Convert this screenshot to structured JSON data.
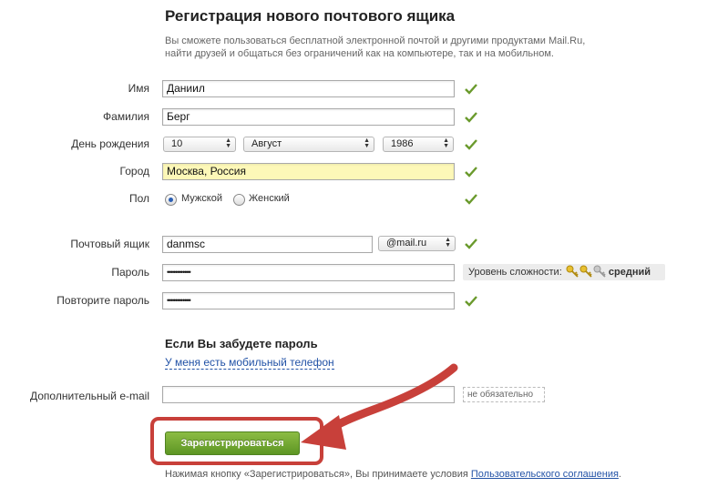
{
  "form": {
    "title": "Регистрация нового почтового ящика",
    "intro_line1": "Вы сможете пользоваться бесплатной электронной почтой и другими продуктами Mail.Ru,",
    "intro_line2": "найти друзей и общаться без ограничений как на компьютере, так и на мобильном.",
    "fields": {
      "name_label": "Имя",
      "name_value": "Даниил",
      "surname_label": "Фамилия",
      "surname_value": "Берг",
      "birthday_label": "День рождения",
      "birth_day": "10",
      "birth_month": "Август",
      "birth_year": "1986",
      "city_label": "Город",
      "city_value": "Москва, Россия",
      "gender_label": "Пол",
      "gender_male": "Мужской",
      "gender_female": "Женский",
      "gender_selected": "Мужской",
      "mailbox_label": "Почтовый ящик",
      "mailbox_value": "danmsc",
      "mailbox_domain": "@mail.ru",
      "password_label": "Пароль",
      "password_mask": "••••••••••••",
      "password_strength_label": "Уровень сложности:",
      "password_strength_value": "средний",
      "repeat_password_label": "Повторите пароль",
      "repeat_password_mask": "••••••••••••"
    },
    "recovery": {
      "heading": "Если Вы забудете пароль",
      "phone_link": "У меня есть мобильный телефон",
      "extra_email_label": "Дополнительный e-mail",
      "extra_email_value": "",
      "optional_hint": "не обязательно"
    },
    "submit_label": "Зарегистрироваться",
    "terms_prefix": "Нажимая кнопку «Зарегистрироваться», Вы принимаете условия ",
    "terms_link": "Пользовательского соглашения",
    "terms_suffix": "."
  },
  "colors": {
    "check": "#6a9a2c",
    "button": "#6da52e",
    "annotation": "#c8403a",
    "link": "#2252a6",
    "city_bg": "#fdf8b8"
  },
  "icons": {
    "valid": "check-icon",
    "dropdown": "updown-arrows-icon",
    "strength": "key-icon"
  }
}
